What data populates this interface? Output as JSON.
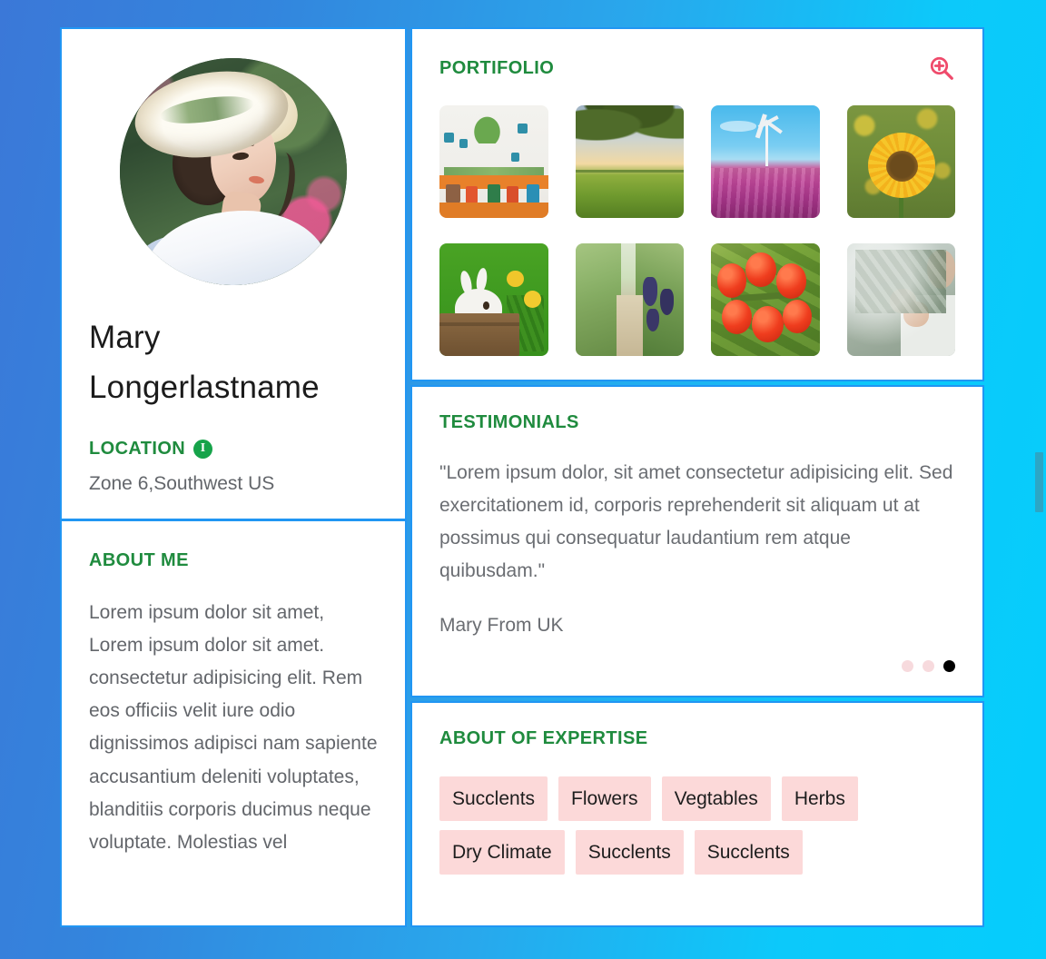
{
  "theme": {
    "accent_green": "#1f8b3e",
    "border_blue": "#2196f3",
    "tag_pink": "#fcd9d9",
    "icon_pink": "#ef4a6b",
    "bg_gradient_from": "#3b78d8",
    "bg_gradient_to": "#05cdfc"
  },
  "profile": {
    "avatar_alt": "woman in white sun hat in a garden",
    "name": "Mary Longerlastname",
    "location_label": "LOCATION",
    "location_info_icon": "info-icon",
    "location_value": "Zone 6,Southwest US"
  },
  "about": {
    "title": "ABOUT ME",
    "body": "Lorem ipsum dolor sit amet, Lorem ipsum dolor sit amet. consectetur adipisicing elit. Rem eos officiis velit iure odio dignissimos adipisci nam sapiente accusantium deleniti voluptates, blanditiis corporis ducimus neque voluptate. Molestias vel"
  },
  "portfolio": {
    "title": "PORTIFOLIO",
    "zoom_icon": "magnifier-plus-icon",
    "items": [
      {
        "alt": "potted plants on an orange shelf"
      },
      {
        "alt": "tree branches over a green field at sunset"
      },
      {
        "alt": "wind turbine above a purple tulip field"
      },
      {
        "alt": "yellow sunflower close up"
      },
      {
        "alt": "white rabbit in a wooden box with dandelions"
      },
      {
        "alt": "vineyard path with grape vines"
      },
      {
        "alt": "ripe red tomatoes on the vine"
      },
      {
        "alt": "hands picking olive branches"
      }
    ]
  },
  "testimonials": {
    "title": "TESTIMONIALS",
    "quote": "\"Lorem ipsum dolor, sit amet consectetur adipisicing elit. Sed exercitationem id, corporis reprehenderit sit aliquam ut at possimus qui consequatur laudantium rem atque quibusdam.\"",
    "author": "Mary From UK",
    "dots_total": 3,
    "dot_active_index": 2
  },
  "expertise": {
    "title": "ABOUT OF EXPERTISE",
    "tags": [
      "Succlents",
      "Flowers",
      "Vegtables",
      "Herbs",
      "Dry Climate",
      "Succlents",
      "Succlents"
    ]
  },
  "scrollbar": {
    "present": true
  }
}
